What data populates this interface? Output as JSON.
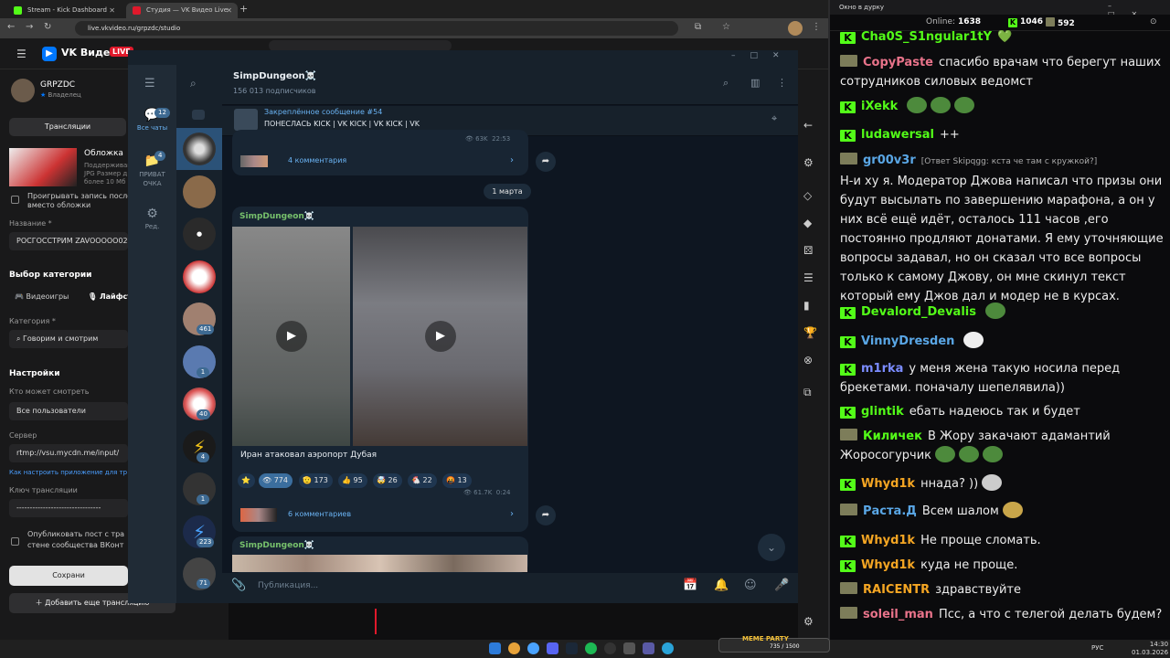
{
  "browser": {
    "tabs": [
      {
        "label": "Stream - Kick Dashboard",
        "color": "#53fc18"
      },
      {
        "label": "Студия — VK Видео Live",
        "color": "#e0192b"
      }
    ],
    "url": "live.vkvideo.ru/grpzdc/studio"
  },
  "vk": {
    "brand": "VK Видео",
    "live": "LIVE",
    "channel_name": "GRPZDC",
    "channel_role": "Владелец",
    "broadcasts_tab": "Трансляции",
    "cover_label": "Обложка",
    "cover_hint_1": "Поддерживаю",
    "cover_hint_2": "JPG Размер д",
    "cover_hint_3": "более 10 Мб",
    "replay_label_1": "Проигрывать запись послед",
    "replay_label_2": "вместо обложки",
    "title_label": "Название *",
    "title_value": "РОСГОССТРИМ ZAVOOOOO02",
    "category_choice_label": "Выбор категории",
    "cat_games": "Видеоигры",
    "cat_life": "Лайфст",
    "category_label": "Категория *",
    "category_value": "Говорим и смотрим",
    "settings_label": "Настройки",
    "who_can_watch_label": "Кто может смотреть",
    "who_can_watch_value": "Все пользователи",
    "server_label": "Сервер",
    "server_value": "rtmp://vsu.mycdn.me/input/",
    "setup_link": "Как настроить приложение для тр",
    "key_label": "Ключ трансляции",
    "key_value": "--------------------------------",
    "publish_1": "Опубликовать пост с тра",
    "publish_2": "стене сообщества ВКонт",
    "save_button": "Сохрани",
    "add_button": "Добавить еще трансляцию"
  },
  "telegram": {
    "folders": [
      {
        "label": "Все чаты",
        "badge": "12"
      },
      {
        "label": "ПРИВАТ ОЧКА",
        "badge": "4"
      },
      {
        "label": "Ред."
      }
    ],
    "chat_badges": [
      "461",
      "1",
      "40",
      "4",
      "1",
      "223",
      "71"
    ],
    "channel_name": "SimpDungeon☠️",
    "subscribers": "156 013 подписчиков",
    "pinned_label": "Закреплённое сообщение #54",
    "pinned_text": "ПОНЕСЛАСЬ  KICK | VK KICK | VK KICK | VK",
    "post1_views": "63K",
    "post1_time": "22:53",
    "post1_comments": "4 комментария",
    "date_divider": "1 марта",
    "post2_author": "SimpDungeon☠️",
    "post2_caption": "Иран атаковал аэропорт Дубая",
    "reactions": [
      {
        "emoji": "⭐",
        "count": ""
      },
      {
        "emoji": "👁",
        "count": "774"
      },
      {
        "emoji": "🫡",
        "count": "173"
      },
      {
        "emoji": "👍",
        "count": "95"
      },
      {
        "emoji": "🤯",
        "count": "26"
      },
      {
        "emoji": "🐔",
        "count": "22"
      },
      {
        "emoji": "🤬",
        "count": "13"
      }
    ],
    "post2_views": "61.7K",
    "post2_time": "0:24",
    "post2_comments": "6 комментариев",
    "post3_author": "SimpDungeon☠️",
    "compose_placeholder": "Публикация..."
  },
  "chat_window": {
    "title": "Окно в дурку",
    "online_label": "Online:",
    "online_count": "1638",
    "kick_viewers": "1046",
    "vk_viewers": "592",
    "messages": [
      {
        "user": "Cha0S_S1ngular1tY",
        "platform": "kick",
        "color": "#53fc18",
        "text": "💚"
      },
      {
        "user": "CopyPaste",
        "platform": "vk",
        "color": "#e8738a",
        "text": "спасибо врачам что берегут наших сотрудников силовых ведомст"
      },
      {
        "user": "iXekk",
        "platform": "kick",
        "color": "#53fc18",
        "text": ""
      },
      {
        "user": "ludawersal",
        "platform": "kick",
        "color": "#53fc18",
        "text": "++"
      },
      {
        "user": "gr00v3r",
        "platform": "vk",
        "color": "#5aa7e6",
        "reply": "[Ответ Skipqgg: кста че там с кружкой?]",
        "text": "Н-и ху я. Модератор Джова написал что призы они будут высылать по завершению марафона, а он у них всё ещё идёт, осталось 111 часов ,его постоянно продляют донатами. Я ему уточняющие вопросы задавал, но он сказал что все вопросы только к самому Джову, он мне скинул текст который ему Джов дал и модер не в курсах."
      },
      {
        "user": "Devalord_Devalis",
        "platform": "kick",
        "color": "#53fc18",
        "text": ""
      },
      {
        "user": "VinnyDresden",
        "platform": "kick",
        "color": "#5aa7e6",
        "text": ""
      },
      {
        "user": "m1rka",
        "platform": "kick",
        "color": "#7b8cff",
        "text": "у меня жена такую носила перед брекетами. поначалу шепелявила))"
      },
      {
        "user": "glintik",
        "platform": "kick",
        "color": "#53fc18",
        "text": "ебать надеюсь так и будет"
      },
      {
        "user": "Киличек",
        "platform": "vk",
        "color": "#53fc18",
        "text": "В Жору закачают адамантий Жоросогурчик"
      },
      {
        "user": "Whyd1k",
        "platform": "kick",
        "color": "#f5a623",
        "text": "ннада? ))"
      },
      {
        "user": "Раста.Д",
        "platform": "vk",
        "color": "#5aa7e6",
        "text": "Всем шалом"
      },
      {
        "user": "Whyd1k",
        "platform": "kick",
        "color": "#f5a623",
        "text": "Не проще сломать."
      },
      {
        "user": "Whyd1k",
        "platform": "kick",
        "color": "#f5a623",
        "text": "куда не проще."
      },
      {
        "user": "RAICENTR",
        "platform": "vk",
        "color": "#f5a623",
        "text": "здравствуйте"
      },
      {
        "user": "soleil_man",
        "platform": "vk",
        "color": "#e8738a",
        "text": "Псс, а что с телегой делать будем?"
      }
    ]
  },
  "taskbar": {
    "meme_label": "MEME PARTY",
    "meme_count": "735 / 1500",
    "lang": "РУС",
    "time": "14:30",
    "date": "01.03.2026"
  }
}
